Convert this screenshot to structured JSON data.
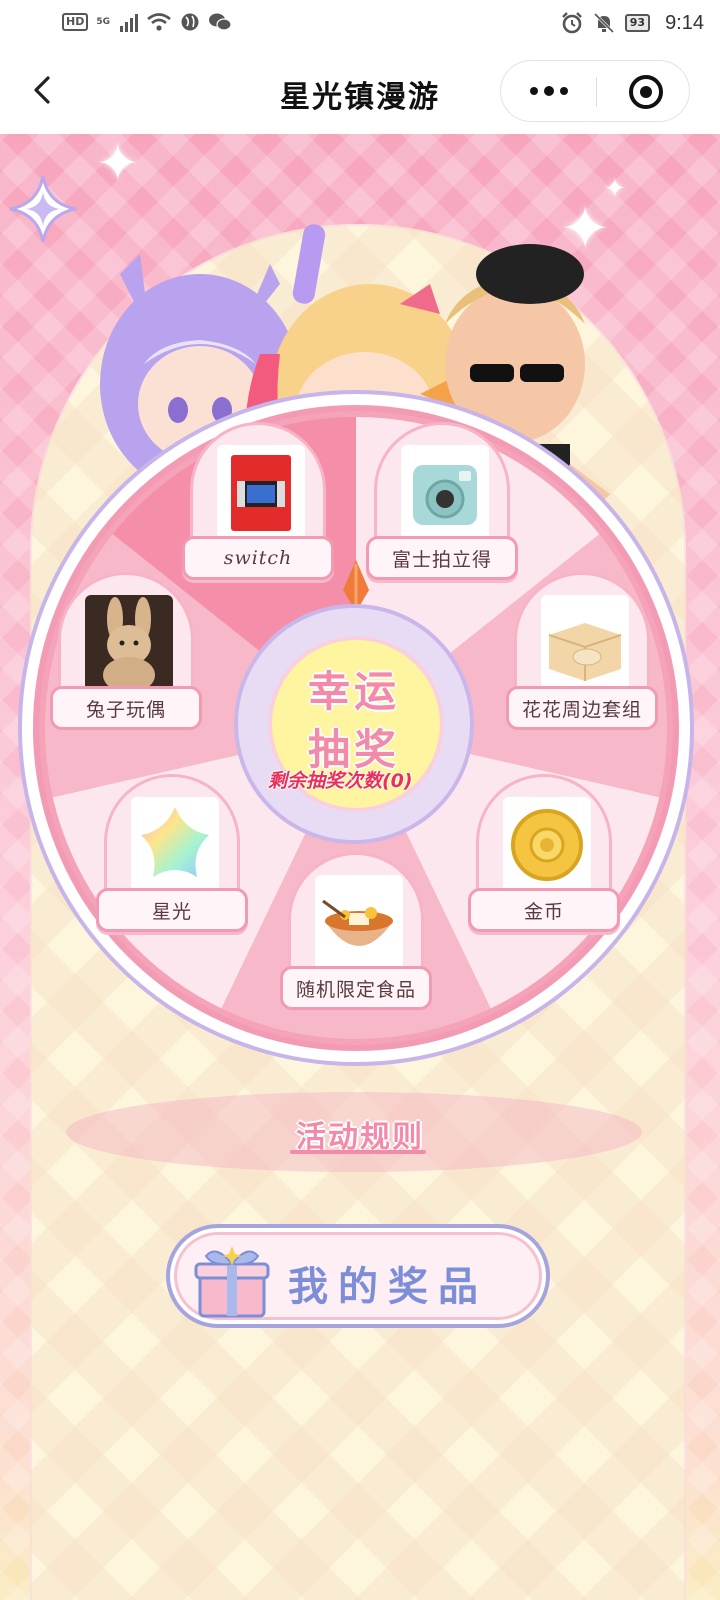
{
  "status_bar": {
    "hd": "HD",
    "network": "5G",
    "battery": "93",
    "time": "9:14"
  },
  "nav": {
    "title": "星光镇漫游"
  },
  "wheel": {
    "center_line1": "幸运",
    "center_line2": "抽奖",
    "remaining": "剩余抽奖次数(0)",
    "prizes": [
      {
        "label": "switch",
        "icon": "switch-console-image"
      },
      {
        "label": "富士拍立得",
        "icon": "instax-camera-image"
      },
      {
        "label": "花花周边套组",
        "icon": "merch-box-image"
      },
      {
        "label": "金币",
        "icon": "gold-coin-image"
      },
      {
        "label": "随机限定食品",
        "icon": "food-bowl-image"
      },
      {
        "label": "星光",
        "icon": "starlight-image"
      },
      {
        "label": "兔子玩偶",
        "icon": "bunny-plush-image"
      }
    ]
  },
  "rules": {
    "label": "活动规则"
  },
  "my_prizes": {
    "label": "我的奖品",
    "icon": "gift-icon"
  },
  "colors": {
    "accent_pink": "#f48aa9",
    "remaining_red": "#e8305b",
    "lavender": "#7c8ed6"
  }
}
